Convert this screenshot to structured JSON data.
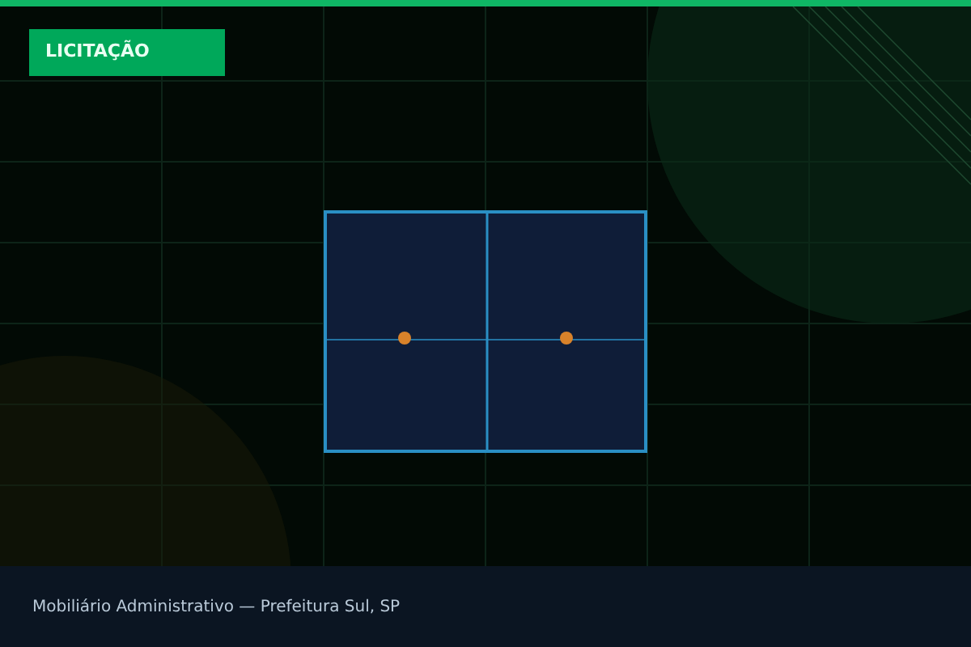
{
  "tag": {
    "label": "LICITAÇÃO"
  },
  "caption": "Mobiliário Administrativo — Prefeitura Sul, SP"
}
